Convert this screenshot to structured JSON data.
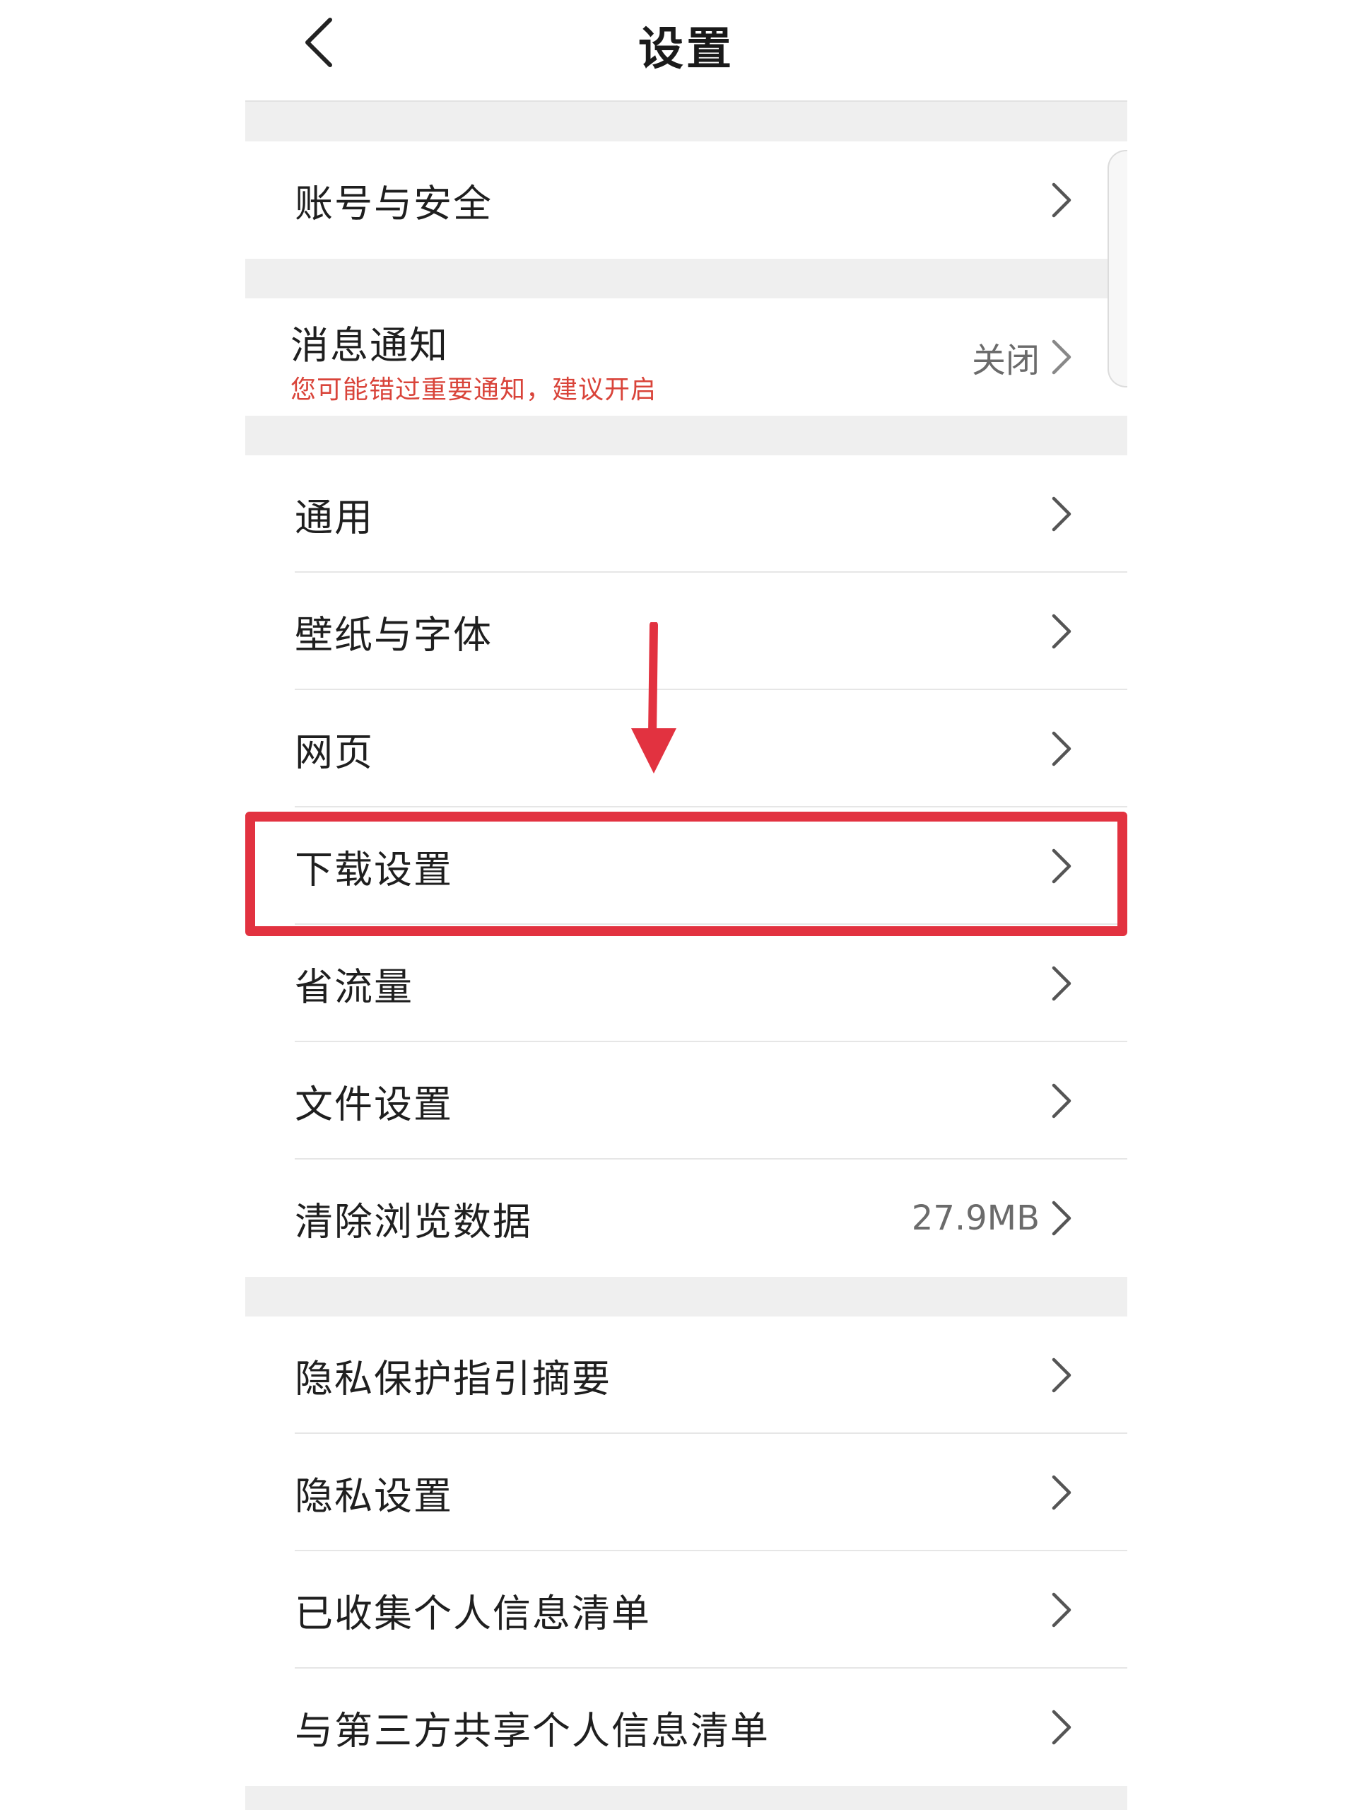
{
  "header": {
    "title": "设置",
    "back_icon": "chevron-left-icon"
  },
  "groups": [
    {
      "rows": [
        {
          "label": "账号与安全"
        }
      ]
    },
    {
      "notification": {
        "title": "消息通知",
        "subtitle": "您可能错过重要通知，建议开启",
        "value": "关闭"
      }
    },
    {
      "rows": [
        {
          "label": "通用"
        },
        {
          "label": "壁纸与字体"
        },
        {
          "label": "网页"
        },
        {
          "label": "下载设置"
        },
        {
          "label": "省流量"
        },
        {
          "label": "文件设置"
        },
        {
          "label": "清除浏览数据",
          "value": "27.9MB"
        }
      ]
    },
    {
      "rows": [
        {
          "label": "隐私保护指引摘要"
        },
        {
          "label": "隐私设置"
        },
        {
          "label": "已收集个人信息清单"
        },
        {
          "label": "与第三方共享个人信息清单"
        }
      ]
    }
  ],
  "colors": {
    "accent_red": "#e23240",
    "warning_text": "#d9443a",
    "background_gap": "#efefef"
  }
}
